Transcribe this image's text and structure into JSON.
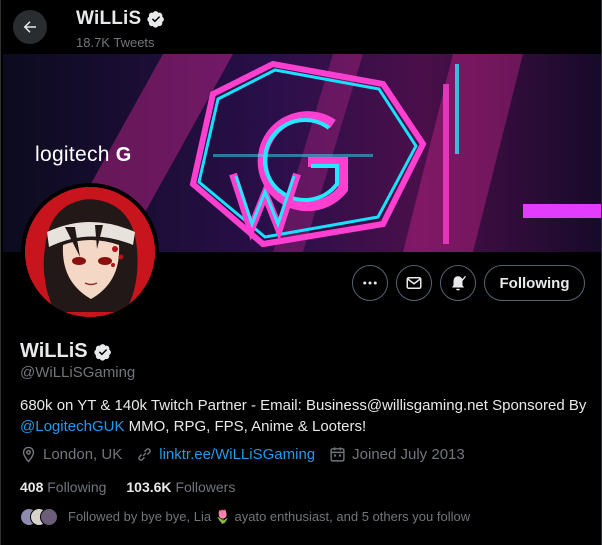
{
  "header": {
    "title": "WiLLiS",
    "tweet_count": "18.7K Tweets"
  },
  "banner": {
    "brand": "logitech"
  },
  "actions": {
    "follow_label": "Following"
  },
  "profile": {
    "name": "WiLLiS",
    "handle": "@WiLLiSGaming",
    "bio_text": "680k on YT & 140k Twitch Partner - Email: Business@willisgaming.net Sponsored By",
    "bio_mention": "@LogitechGUK",
    "bio_rest": " MMO, RPG, FPS, Anime & Looters!",
    "location": "London, UK",
    "website": "linktr.ee/WiLLiSGaming",
    "joined": "Joined July 2013",
    "following_count": "408",
    "following_label": "Following",
    "followers_count": "103.6K",
    "followers_label": "Followers",
    "followed_by": "Followed by bye bye, Lia 🌷 ayato enthusiast, and 5 others you follow"
  },
  "colors": {
    "background": "#000000",
    "text": "#e7e9ea",
    "muted": "#71767b",
    "accent": "#1d9bf0",
    "border": "#536471"
  }
}
